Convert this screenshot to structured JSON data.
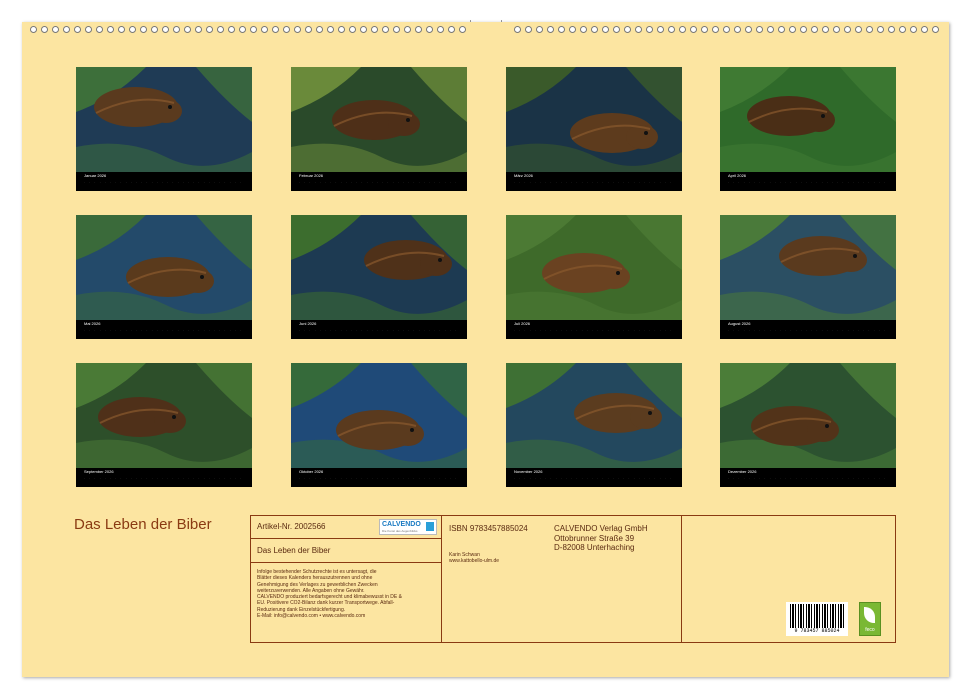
{
  "calendar_title": "Das Leben der Biber",
  "months": [
    {
      "caption": "Januar 2026"
    },
    {
      "caption": "Februar 2026"
    },
    {
      "caption": "März 2026"
    },
    {
      "caption": "April 2026"
    },
    {
      "caption": "Mai 2026"
    },
    {
      "caption": "Juni 2026"
    },
    {
      "caption": "Juli 2026"
    },
    {
      "caption": "August 2026"
    },
    {
      "caption": "September 2026"
    },
    {
      "caption": "Oktober 2026"
    },
    {
      "caption": "November 2026"
    },
    {
      "caption": "Dezember 2026"
    }
  ],
  "imprint": {
    "article": "Artikel-Nr. 2002566",
    "logo_text": "CALVENDO",
    "logo_subtitle": "Die Kunst des Augenblicks",
    "isbn": "ISBN 9783457885024",
    "publisher_name": "CALVENDO Verlag GmbH",
    "publisher_street": "Ottobrunner Straße 39",
    "publisher_city": "D-82008 Unterhaching",
    "product_title": "Das Leben der Biber",
    "author": "Karin Schwan",
    "author_url": "www.kattobello-ulm.de",
    "legal_1": "Infolge bestehender Schutzrechte ist es untersagt, die",
    "legal_2": "Blätter dieses Kalenders herauszutrennen und ohne",
    "legal_3": "Genehmigung des Verlages zu gewerblichen Zwecken",
    "legal_4": "weiterzuverwenden. Alle Angaben ohne Gewähr.",
    "legal_5": "CALVENDO produziert bedarfsgerecht und klimabewusst in DE &",
    "legal_6": "EU. Positivere CO2-Bilanz dank kurzer Transportwege. Abfall-",
    "legal_7": "Reduzierung dank Einzelstückfertigung.",
    "legal_8": "E-Mail: info@calvendo.com • www.calvendo.com",
    "barcode_number": "9 783457 885024",
    "eco_label": "feco"
  },
  "colors": {
    "background": "#fce5a1",
    "accent": "#8a3a12"
  }
}
